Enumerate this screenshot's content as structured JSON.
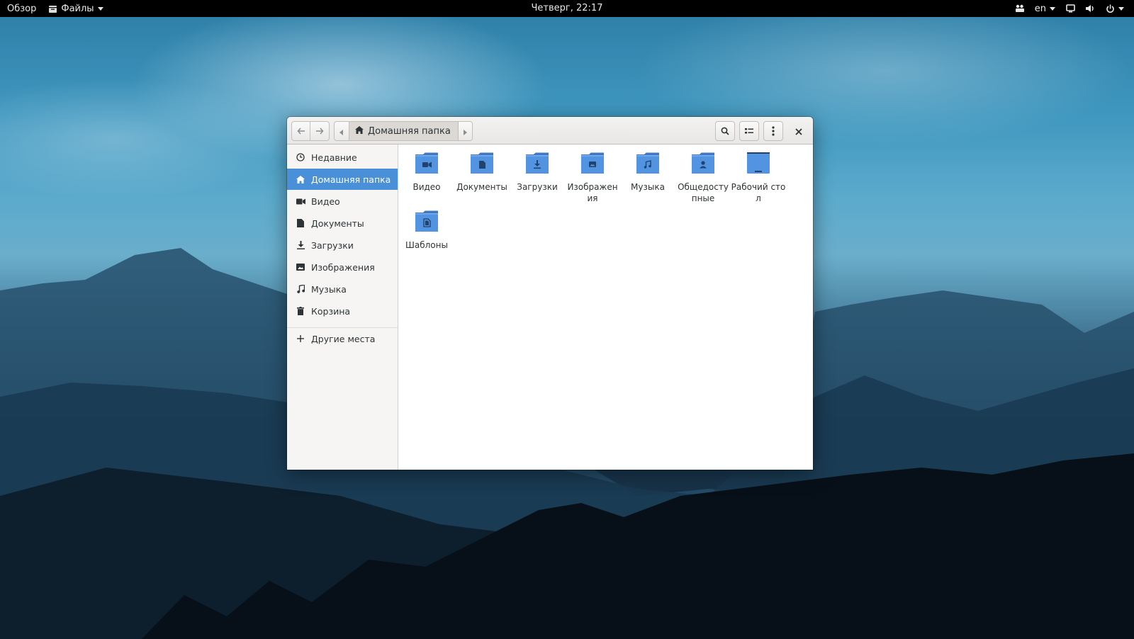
{
  "topbar": {
    "activities": "Обзор",
    "app_menu": "Файлы",
    "clock": "Четверг, 22:17",
    "language": "en",
    "icons": [
      "apps-icon",
      "screen-icon",
      "volume-icon",
      "power-icon"
    ]
  },
  "window": {
    "path_current": "Домашняя папка",
    "buttons": [
      "back-icon",
      "forward-icon",
      "search-icon",
      "view-list-icon",
      "menu-icon",
      "close-icon"
    ]
  },
  "sidebar": {
    "items": [
      {
        "label": "Недавние",
        "icon": "clock-icon"
      },
      {
        "label": "Домашняя папка",
        "icon": "home-icon",
        "active": true
      },
      {
        "label": "Видео",
        "icon": "video-icon"
      },
      {
        "label": "Документы",
        "icon": "document-icon"
      },
      {
        "label": "Загрузки",
        "icon": "download-icon"
      },
      {
        "label": "Изображения",
        "icon": "image-icon"
      },
      {
        "label": "Музыка",
        "icon": "music-icon"
      },
      {
        "label": "Корзина",
        "icon": "trash-icon"
      },
      {
        "label": "Другие места",
        "icon": "plus-icon"
      }
    ]
  },
  "content": {
    "items": [
      {
        "label": "Видео",
        "icon": "video-folder-icon"
      },
      {
        "label": "Документы",
        "icon": "documents-folder-icon"
      },
      {
        "label": "Загрузки",
        "icon": "downloads-folder-icon"
      },
      {
        "label": "Изображения",
        "icon": "pictures-folder-icon"
      },
      {
        "label": "Музыка",
        "icon": "music-folder-icon"
      },
      {
        "label": "Общедоступные",
        "icon": "public-folder-icon"
      },
      {
        "label": "Рабочий стол",
        "icon": "desktop-folder-icon"
      },
      {
        "label": "Шаблоны",
        "icon": "templates-folder-icon"
      }
    ]
  },
  "colors": {
    "accent": "#4a90d9",
    "folder": "#5294e2",
    "folder_dark": "#3d78c4"
  }
}
